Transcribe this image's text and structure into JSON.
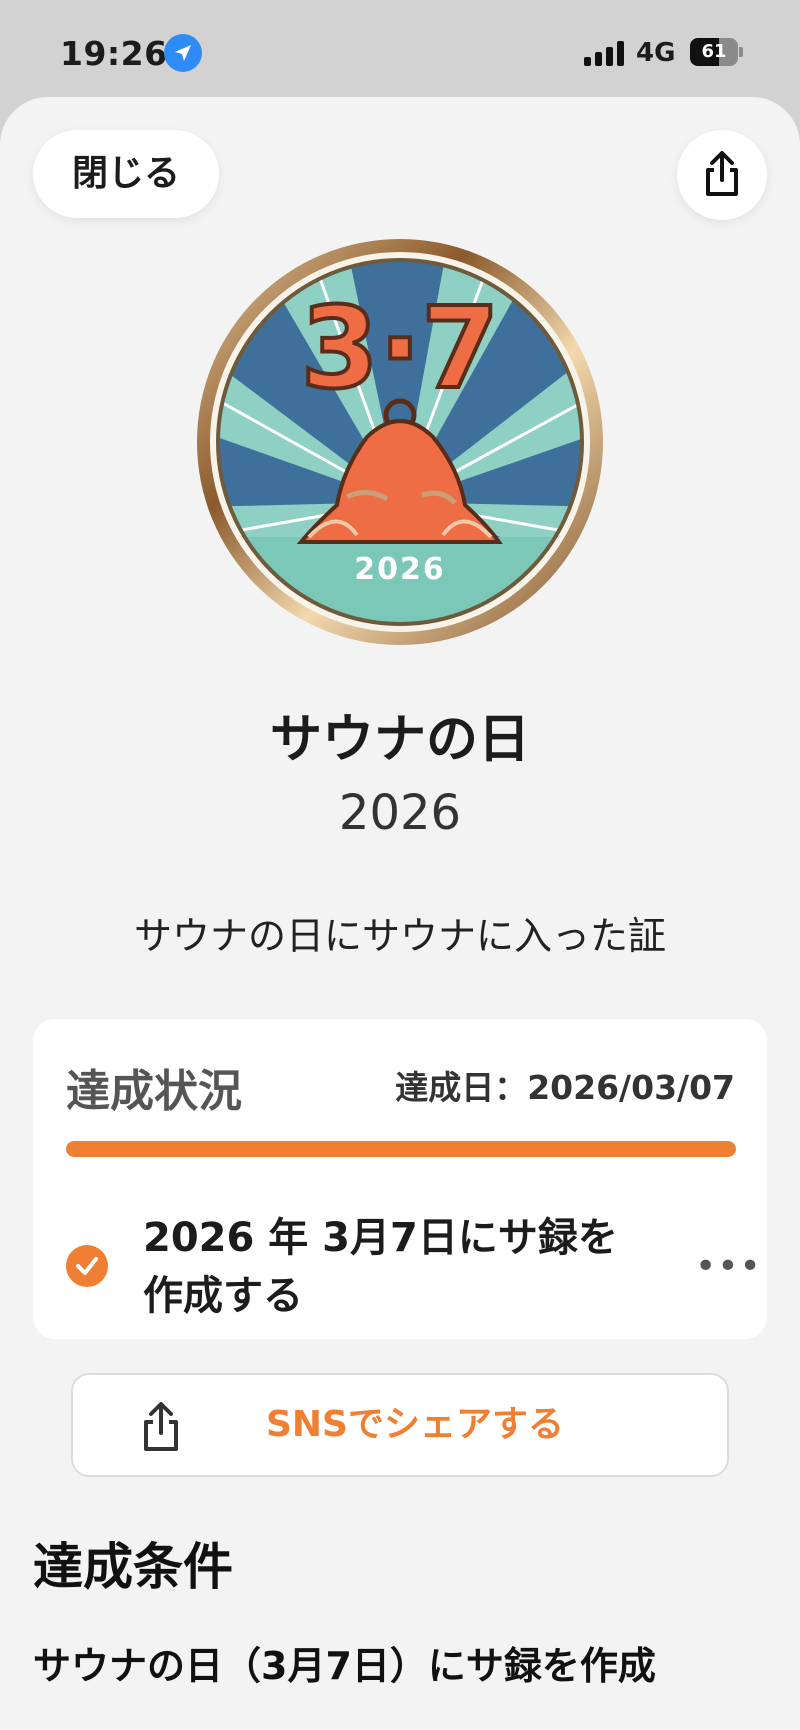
{
  "status_bar": {
    "time": "19:26",
    "network": "4G",
    "battery_level": "61",
    "battery_fraction": 0.61,
    "signal_bars": 4
  },
  "header": {
    "close_label": "閉じる",
    "share_icon": "share-icon"
  },
  "badge": {
    "date_text": "3·7",
    "year_text": "2026",
    "colors": {
      "ring": "#a97a47",
      "sky_light": "#8fd0c4",
      "sky_dark": "#3e6f9b",
      "hat": "#ee6d45"
    }
  },
  "achievement": {
    "title": "サウナの日",
    "year": "2026",
    "description": "サウナの日にサウナに入った証"
  },
  "status_card": {
    "title": "達成状況",
    "achieved_date": "達成日：2026/03/07",
    "progress": 1.0,
    "task_line1": "2026 年 3月7日にサ録を",
    "task_line2": "作成する",
    "more_icon": "more-icon"
  },
  "sns_share": {
    "label": "SNSでシェアする"
  },
  "conditions": {
    "title": "達成条件",
    "text": "サウナの日（3月7日）にサ録を作成"
  },
  "colors": {
    "accent": "#ef7f33",
    "sheet_bg": "#f3f3f3",
    "card_bg": "#ffffff"
  }
}
